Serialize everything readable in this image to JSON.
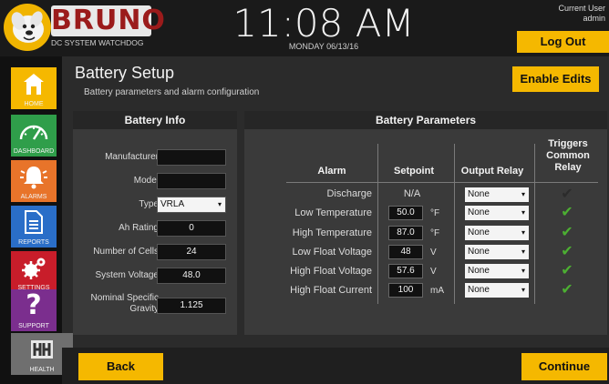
{
  "header": {
    "brand": "BRUNO",
    "brand_sub": "DC SYSTEM WATCHDOG",
    "time": "11:08 AM",
    "date": "MONDAY 06/13/16",
    "user_label": "Current User",
    "user_name": "admin",
    "logout_label": "Log Out"
  },
  "sidebar": {
    "items": [
      {
        "label": "HOME",
        "icon": "home-icon"
      },
      {
        "label": "DASHBOARD",
        "icon": "gauge-icon"
      },
      {
        "label": "ALARMS",
        "icon": "bell-icon"
      },
      {
        "label": "REPORTS",
        "icon": "document-icon"
      },
      {
        "label": "SETTINGS",
        "icon": "gears-icon"
      },
      {
        "label": "SUPPORT",
        "icon": "question-icon"
      },
      {
        "label": "HEALTH",
        "icon": "health-logo-icon"
      }
    ]
  },
  "page": {
    "title": "Battery Setup",
    "subtitle": "Battery parameters and alarm configuration",
    "enable_edits_label": "Enable Edits"
  },
  "battery_info": {
    "title": "Battery Info",
    "fields": [
      {
        "label": "Manufacturer",
        "value": ""
      },
      {
        "label": "Model",
        "value": ""
      },
      {
        "label": "Type",
        "value": "VRLA"
      },
      {
        "label": "Ah Rating",
        "value": "0"
      },
      {
        "label": "Number of Cells",
        "value": "24"
      },
      {
        "label": "System Voltage",
        "value": "48.0"
      },
      {
        "label": "Nominal Specific Gravity",
        "value": "1.125"
      }
    ]
  },
  "battery_params": {
    "title": "Battery Parameters",
    "columns": {
      "alarm": "Alarm",
      "setpoint": "Setpoint",
      "relay": "Output Relay",
      "triggers": "Triggers Common Relay"
    },
    "rows": [
      {
        "alarm": "Discharge",
        "setpoint": "N/A",
        "unit": "",
        "relay": "None",
        "triggers_color": "#2b2b2b"
      },
      {
        "alarm": "Low Temperature",
        "setpoint": "50.0",
        "unit": "°F",
        "relay": "None",
        "triggers_color": "#4caf32"
      },
      {
        "alarm": "High Temperature",
        "setpoint": "87.0",
        "unit": "°F",
        "relay": "None",
        "triggers_color": "#4caf32"
      },
      {
        "alarm": "Low Float Voltage",
        "setpoint": "48",
        "unit": "V",
        "relay": "None",
        "triggers_color": "#4caf32"
      },
      {
        "alarm": "High Float Voltage",
        "setpoint": "57.6",
        "unit": "V",
        "relay": "None",
        "triggers_color": "#4caf32"
      },
      {
        "alarm": "High Float Current",
        "setpoint": "100",
        "unit": "mA",
        "relay": "None",
        "triggers_color": "#4caf32"
      }
    ]
  },
  "footer": {
    "back_label": "Back",
    "continue_label": "Continue"
  }
}
